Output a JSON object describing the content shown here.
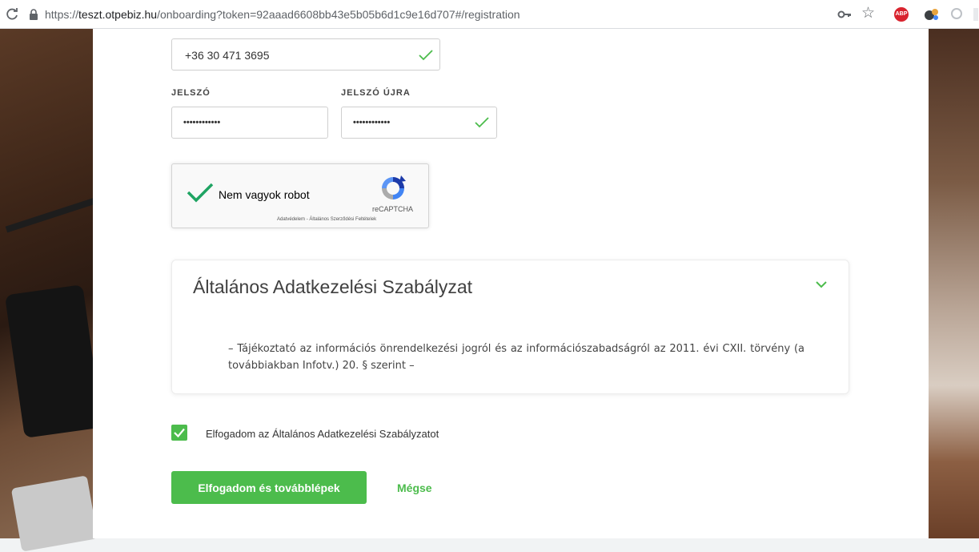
{
  "browser": {
    "url_prefix": "https://",
    "url_host": "teszt.otpebiz.hu",
    "url_path": "/onboarding?token=92aaad6608bb43e5b05b6d1c9e16d707#/registration",
    "extension_abp_label": "ABP"
  },
  "form": {
    "phone_value": "+36 30 471 3695",
    "password_label": "JELSZÓ",
    "password_repeat_label": "JELSZÓ ÚJRA",
    "password_value": "••••••••••••",
    "password_repeat_value": "••••••••••••"
  },
  "recaptcha": {
    "label": "Nem vagyok robot",
    "brand": "reCAPTCHA",
    "terms": "Adatvédelem - Általános Szerződési Feltételek"
  },
  "policy": {
    "title": "Általános Adatkezelési Szabályzat",
    "body": "– Tájékoztató az információs önrendelkezési jogról és az információszabadságról az 2011. évi CXII. törvény (a továbbiakban Infotv.) 20. § szerint –"
  },
  "consent": {
    "checked": true,
    "label": "Elfogadom az Általános Adatkezelési Szabályzatot"
  },
  "actions": {
    "accept_label": "Elfogadom és továbblépek",
    "cancel_label": "Mégse"
  },
  "colors": {
    "accent": "#4cbc4c",
    "recaptcha_blue": "#1c3aa9"
  }
}
